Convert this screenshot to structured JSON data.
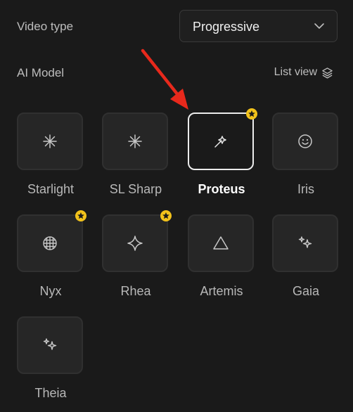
{
  "video_type": {
    "label": "Video type",
    "selected": "Progressive"
  },
  "ai_model": {
    "label": "AI Model",
    "list_view_label": "List view"
  },
  "models": [
    {
      "name": "Starlight",
      "icon": "sparkle-asterisk-icon",
      "premium": false,
      "selected": false
    },
    {
      "name": "SL Sharp",
      "icon": "sparkle-asterisk-icon",
      "premium": false,
      "selected": false
    },
    {
      "name": "Proteus",
      "icon": "magic-wand-icon",
      "premium": true,
      "selected": true
    },
    {
      "name": "Iris",
      "icon": "smiley-face-icon",
      "premium": false,
      "selected": false
    },
    {
      "name": "Nyx",
      "icon": "grid-globe-icon",
      "premium": true,
      "selected": false
    },
    {
      "name": "Rhea",
      "icon": "four-point-star-icon",
      "premium": true,
      "selected": false
    },
    {
      "name": "Artemis",
      "icon": "triangle-icon",
      "premium": false,
      "selected": false
    },
    {
      "name": "Gaia",
      "icon": "sparkles-icon",
      "premium": false,
      "selected": false
    },
    {
      "name": "Theia",
      "icon": "sparkles-icon",
      "premium": false,
      "selected": false
    }
  ],
  "colors": {
    "background": "#1a1a1a",
    "tile": "#262626",
    "premium_badge": "#f2c21b",
    "annotation_arrow": "#e8291c"
  }
}
